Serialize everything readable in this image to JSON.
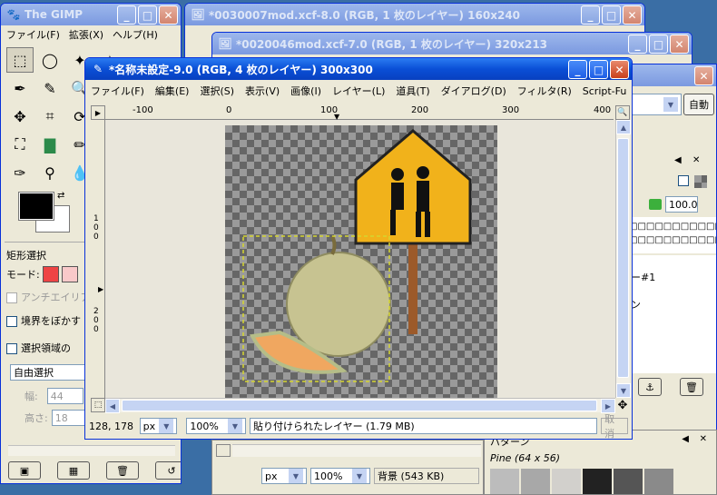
{
  "toolbox": {
    "title": "The GIMP",
    "menu": [
      "ファイル(F)",
      "拡張(X)",
      "ヘルプ(H)"
    ],
    "tool_options_title": "矩形選択",
    "mode_label": "モード:",
    "antialias_label": "アンチエイリア",
    "feather_label": "境界をぼかす",
    "rounded_label": "選択領域の",
    "select_mode_value": "自由選択",
    "width_label": "幅:",
    "width_value": "44",
    "height_label": "高さ:",
    "height_value": "18"
  },
  "back_window1": {
    "title": "*0030007mod.xcf-8.0 (RGB, 1 枚のレイヤー) 160x240"
  },
  "back_window2": {
    "title": "*0020046mod.xcf-7.0 (RGB, 1 枚のレイヤー) 320x213"
  },
  "main_window": {
    "title": "*名称未設定-9.0 (RGB, 4 枚のレイヤー) 300x300",
    "menu": [
      "ファイル(F)",
      "編集(E)",
      "選択(S)",
      "表示(V)",
      "画像(I)",
      "レイヤー(L)",
      "道具(T)",
      "ダイアログ(D)",
      "フィルタ(R)",
      "Script-Fu"
    ],
    "ruler_ticks": [
      "-100",
      "0",
      "100",
      "200",
      "300",
      "400"
    ],
    "vruler_ticks": [
      "1\n0\n0",
      "2\n0\n0"
    ],
    "coords": "128, 178",
    "unit": "px",
    "zoom": "100%",
    "status_message": "貼り付けられたレイヤー (1.79 MB)",
    "cancel_label": "取消"
  },
  "bottom_window": {
    "unit": "px",
    "zoom": "100%",
    "status_message": "背景 (543 KB)"
  },
  "layers_dock": {
    "auto_label": "自動",
    "opacity_value": "100.0",
    "layer_name_1": "□□□□□□□□□□□□",
    "layer_name_2": "□□□□□□□□□□□□",
    "layer_item": "ー#1",
    "layer_item2": "ン"
  },
  "pattern_dock": {
    "title": "パターン",
    "pattern_name": "Pine (64 x 56)"
  },
  "sign_colors": {
    "sign": "#f1b21b",
    "post": "#9c5a2a"
  }
}
